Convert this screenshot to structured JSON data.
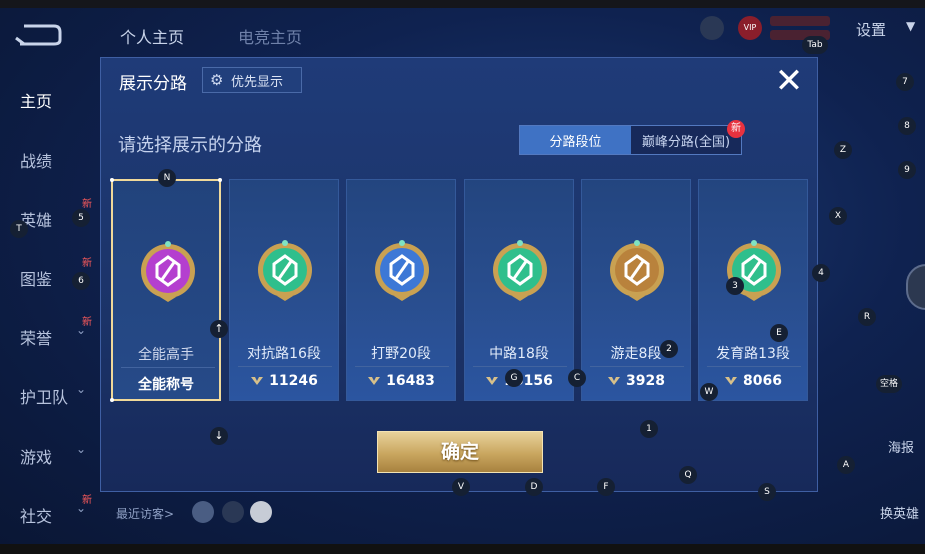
{
  "background": {
    "top_tabs": [
      "个人主页",
      "电竞主页"
    ],
    "settings_label": "设置",
    "vip_label": "VIP",
    "sidenav": [
      {
        "label": "主页",
        "new": "",
        "chevron": ""
      },
      {
        "label": "战绩",
        "new": "",
        "chevron": ""
      },
      {
        "label": "英雄",
        "new": "新",
        "chevron": ""
      },
      {
        "label": "图鉴",
        "new": "新",
        "chevron": ""
      },
      {
        "label": "荣誉",
        "new": "新",
        "chevron": "⌄"
      },
      {
        "label": "护卫队",
        "new": "",
        "chevron": "⌄"
      },
      {
        "label": "游戏",
        "new": "",
        "chevron": "⌄"
      },
      {
        "label": "社交",
        "new": "新",
        "chevron": "⌄"
      }
    ],
    "recent_visitors_label": "最近访客>",
    "right_buttons": [
      "海报",
      "换英雄"
    ]
  },
  "modal": {
    "title": "展示分路",
    "priority_button": "优先显示",
    "close_icon": "✕",
    "subtitle": "请选择展示的分路",
    "segment": {
      "active": "分路段位",
      "inactive": "巅峰分路(全国)",
      "new_badge": "新"
    },
    "cards": [
      {
        "lane": "全能高手",
        "bottom": "全能称号",
        "has_score": false,
        "emblem": "purple-allround-emblem",
        "color": "#b43fcf",
        "selected": true
      },
      {
        "lane": "对抗路16段",
        "bottom": "11246",
        "has_score": true,
        "emblem": "clash-lane-emblem",
        "color": "#2fbf8c",
        "selected": false
      },
      {
        "lane": "打野20段",
        "bottom": "16483",
        "has_score": true,
        "emblem": "jungle-emblem",
        "color": "#3d78d6",
        "selected": false
      },
      {
        "lane": "中路18段",
        "bottom": "15156",
        "has_score": true,
        "emblem": "mid-lane-emblem",
        "color": "#2fbf8c",
        "selected": false
      },
      {
        "lane": "游走8段",
        "bottom": "3928",
        "has_score": true,
        "emblem": "roam-emblem",
        "color": "#b9823c",
        "selected": false
      },
      {
        "lane": "发育路13段",
        "bottom": "8066",
        "has_score": true,
        "emblem": "farm-lane-emblem",
        "color": "#2fbf8c",
        "selected": false
      }
    ],
    "confirm_label": "确定"
  },
  "hints": [
    "Tab",
    "7",
    "8",
    "9",
    "Z",
    "X",
    "4",
    "R",
    "E",
    "空格",
    "N",
    "5",
    "6",
    "T",
    "3",
    "2",
    "G",
    "C",
    "W",
    "1",
    "A",
    "Q",
    "S",
    "V",
    "D",
    "F",
    "↑",
    "↓"
  ]
}
